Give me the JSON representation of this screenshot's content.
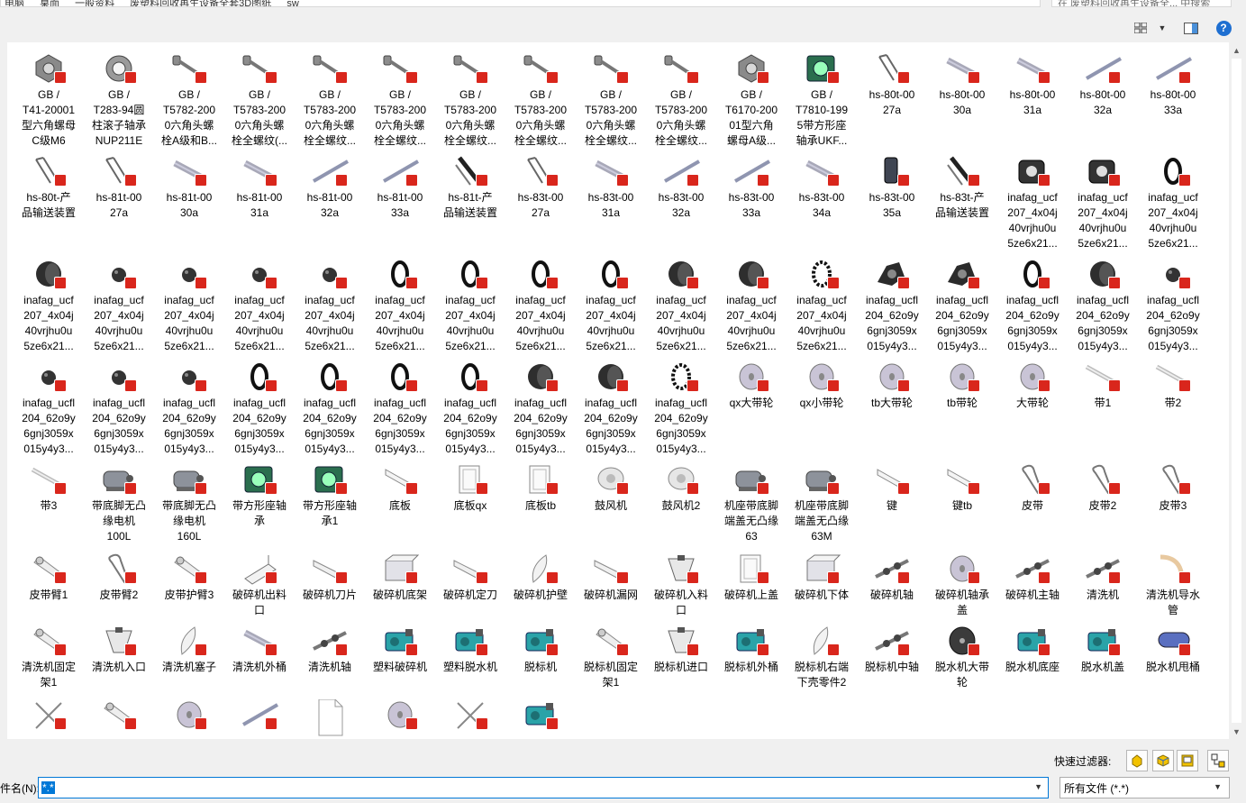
{
  "address": {
    "crumbs": [
      "电脑",
      "桌面",
      "一般资料",
      "废塑料回收再生设备全套3D图纸",
      "sw"
    ],
    "search_placeholder": "在 废塑料回收再生设备全... 中搜索"
  },
  "toolbar": {
    "views_icon": "grid-view-icon",
    "pane_icon": "preview-pane-icon",
    "help_label": "?"
  },
  "files": [
    {
      "label": "GB /\nT41-20001\n型六角螺母\nC级M6",
      "icon": "nut"
    },
    {
      "label": "GB /\nT283-94圆\n柱滚子轴承\nNUP211E",
      "icon": "bearing"
    },
    {
      "label": "GB /\nT5782-200\n0六角头螺\n栓A级和B...",
      "icon": "bolt"
    },
    {
      "label": "GB /\nT5783-200\n0六角头螺\n栓全螺纹(...",
      "icon": "bolt"
    },
    {
      "label": "GB /\nT5783-200\n0六角头螺\n栓全螺纹...",
      "icon": "bolt"
    },
    {
      "label": "GB /\nT5783-200\n0六角头螺\n栓全螺纹...",
      "icon": "bolt"
    },
    {
      "label": "GB /\nT5783-200\n0六角头螺\n栓全螺纹...",
      "icon": "bolt"
    },
    {
      "label": "GB /\nT5783-200\n0六角头螺\n栓全螺纹...",
      "icon": "bolt"
    },
    {
      "label": "GB /\nT5783-200\n0六角头螺\n栓全螺纹...",
      "icon": "bolt"
    },
    {
      "label": "GB /\nT5783-200\n0六角头螺\n栓全螺纹...",
      "icon": "bolt"
    },
    {
      "label": "GB /\nT6170-200\n01型六角\n螺母A级...",
      "icon": "nut"
    },
    {
      "label": "GB /\nT7810-199\n5带方形座\n轴承UKF...",
      "icon": "housing"
    },
    {
      "label": "hs-80t-00\n27a",
      "icon": "frame"
    },
    {
      "label": "hs-80t-00\n30a",
      "icon": "tube"
    },
    {
      "label": "hs-80t-00\n31a",
      "icon": "tube"
    },
    {
      "label": "hs-80t-00\n32a",
      "icon": "rod"
    },
    {
      "label": "hs-80t-00\n33a",
      "icon": "rod"
    },
    {
      "label": "hs-80t-产\n品输送装置",
      "icon": "frame"
    },
    {
      "label": "hs-81t-00\n27a",
      "icon": "frame"
    },
    {
      "label": "hs-81t-00\n30a",
      "icon": "tube"
    },
    {
      "label": "hs-81t-00\n31a",
      "icon": "tube"
    },
    {
      "label": "hs-81t-00\n32a",
      "icon": "rod"
    },
    {
      "label": "hs-81t-00\n33a",
      "icon": "rod"
    },
    {
      "label": "hs-81t-产\n品输送装置",
      "icon": "conveyor"
    },
    {
      "label": "hs-83t-00\n27a",
      "icon": "frame"
    },
    {
      "label": "hs-83t-00\n31a",
      "icon": "tube"
    },
    {
      "label": "hs-83t-00\n32a",
      "icon": "rod"
    },
    {
      "label": "hs-83t-00\n33a",
      "icon": "rod"
    },
    {
      "label": "hs-83t-00\n34a",
      "icon": "tube"
    },
    {
      "label": "hs-83t-00\n35a",
      "icon": "block"
    },
    {
      "label": "hs-83t-产\n品输送装置",
      "icon": "conveyor"
    },
    {
      "label": "inafag_ucf\n207_4x04j\n40vrjhu0u\n5ze6x21...",
      "icon": "housing-dark"
    },
    {
      "label": "inafag_ucf\n207_4x04j\n40vrjhu0u\n5ze6x21...",
      "icon": "housing-dark"
    },
    {
      "label": "inafag_ucf\n207_4x04j\n40vrjhu0u\n5ze6x21...",
      "icon": "ring"
    },
    {
      "label": "inafag_ucf\n207_4x04j\n40vrjhu0u\n5ze6x21...",
      "icon": "cylinder"
    },
    {
      "label": "inafag_ucf\n207_4x04j\n40vrjhu0u\n5ze6x21...",
      "icon": "ball"
    },
    {
      "label": "inafag_ucf\n207_4x04j\n40vrjhu0u\n5ze6x21...",
      "icon": "ball"
    },
    {
      "label": "inafag_ucf\n207_4x04j\n40vrjhu0u\n5ze6x21...",
      "icon": "ball"
    },
    {
      "label": "inafag_ucf\n207_4x04j\n40vrjhu0u\n5ze6x21...",
      "icon": "ball"
    },
    {
      "label": "inafag_ucf\n207_4x04j\n40vrjhu0u\n5ze6x21...",
      "icon": "ring"
    },
    {
      "label": "inafag_ucf\n207_4x04j\n40vrjhu0u\n5ze6x21...",
      "icon": "ring"
    },
    {
      "label": "inafag_ucf\n207_4x04j\n40vrjhu0u\n5ze6x21...",
      "icon": "ring"
    },
    {
      "label": "inafag_ucf\n207_4x04j\n40vrjhu0u\n5ze6x21...",
      "icon": "ring"
    },
    {
      "label": "inafag_ucf\n207_4x04j\n40vrjhu0u\n5ze6x21...",
      "icon": "cylinder"
    },
    {
      "label": "inafag_ucf\n207_4x04j\n40vrjhu0u\n5ze6x21...",
      "icon": "cylinder"
    },
    {
      "label": "inafag_ucf\n207_4x04j\n40vrjhu0u\n5ze6x21...",
      "icon": "ring-dashed"
    },
    {
      "label": "inafag_ucfl\n204_62o9y\n6gnj3059x\n015y4y3...",
      "icon": "flange"
    },
    {
      "label": "inafag_ucfl\n204_62o9y\n6gnj3059x\n015y4y3...",
      "icon": "flange"
    },
    {
      "label": "inafag_ucfl\n204_62o9y\n6gnj3059x\n015y4y3...",
      "icon": "ring"
    },
    {
      "label": "inafag_ucfl\n204_62o9y\n6gnj3059x\n015y4y3...",
      "icon": "cylinder"
    },
    {
      "label": "inafag_ucfl\n204_62o9y\n6gnj3059x\n015y4y3...",
      "icon": "ball"
    },
    {
      "label": "inafag_ucfl\n204_62o9y\n6gnj3059x\n015y4y3...",
      "icon": "ball"
    },
    {
      "label": "inafag_ucfl\n204_62o9y\n6gnj3059x\n015y4y3...",
      "icon": "ball"
    },
    {
      "label": "inafag_ucfl\n204_62o9y\n6gnj3059x\n015y4y3...",
      "icon": "ball"
    },
    {
      "label": "inafag_ucfl\n204_62o9y\n6gnj3059x\n015y4y3...",
      "icon": "ring"
    },
    {
      "label": "inafag_ucfl\n204_62o9y\n6gnj3059x\n015y4y3...",
      "icon": "ring"
    },
    {
      "label": "inafag_ucfl\n204_62o9y\n6gnj3059x\n015y4y3...",
      "icon": "ring"
    },
    {
      "label": "inafag_ucfl\n204_62o9y\n6gnj3059x\n015y4y3...",
      "icon": "ring"
    },
    {
      "label": "inafag_ucfl\n204_62o9y\n6gnj3059x\n015y4y3...",
      "icon": "cylinder"
    },
    {
      "label": "inafag_ucfl\n204_62o9y\n6gnj3059x\n015y4y3...",
      "icon": "cylinder"
    },
    {
      "label": "inafag_ucfl\n204_62o9y\n6gnj3059x\n015y4y3...",
      "icon": "ring-dashed"
    },
    {
      "label": "qx大带轮",
      "icon": "pulley"
    },
    {
      "label": "qx小带轮",
      "icon": "pulley"
    },
    {
      "label": "tb大带轮",
      "icon": "pulley"
    },
    {
      "label": "tb带轮",
      "icon": "pulley"
    },
    {
      "label": "大带轮",
      "icon": "pulley"
    },
    {
      "label": "带1",
      "icon": "belt"
    },
    {
      "label": "带2",
      "icon": "belt"
    },
    {
      "label": "带3",
      "icon": "belt"
    },
    {
      "label": "带底脚无凸\n缘电机\n100L",
      "icon": "motor"
    },
    {
      "label": "带底脚无凸\n缘电机\n160L",
      "icon": "motor"
    },
    {
      "label": "带方形座轴\n承",
      "icon": "housing"
    },
    {
      "label": "带方形座轴\n承1",
      "icon": "housing"
    },
    {
      "label": "底板",
      "icon": "plate"
    },
    {
      "label": "底板qx",
      "icon": "panel"
    },
    {
      "label": "底板tb",
      "icon": "panel"
    },
    {
      "label": "鼓风机",
      "icon": "fan"
    },
    {
      "label": "鼓风机2",
      "icon": "fan"
    },
    {
      "label": "机座带底脚\n端盖无凸缘\n63",
      "icon": "motor"
    },
    {
      "label": "机座带底脚\n端盖无凸缘\n63M",
      "icon": "motor"
    },
    {
      "label": "键",
      "icon": "plate"
    },
    {
      "label": "键tb",
      "icon": "plate"
    },
    {
      "label": "皮带",
      "icon": "loop"
    },
    {
      "label": "皮带2",
      "icon": "loop"
    },
    {
      "label": "皮带3",
      "icon": "loop"
    },
    {
      "label": "皮带臂1",
      "icon": "arm"
    },
    {
      "label": "皮带臂2",
      "icon": "loop"
    },
    {
      "label": "皮带护臂3",
      "icon": "arm"
    },
    {
      "label": "破碎机出料\n口",
      "icon": "chute"
    },
    {
      "label": "破碎机刀片",
      "icon": "blade"
    },
    {
      "label": "破碎机底架",
      "icon": "box"
    },
    {
      "label": "破碎机定刀",
      "icon": "blade"
    },
    {
      "label": "破碎机护壁",
      "icon": "leaf"
    },
    {
      "label": "破碎机漏网",
      "icon": "blade"
    },
    {
      "label": "破碎机入料\n口",
      "icon": "hopper"
    },
    {
      "label": "破碎机上盖",
      "icon": "panel"
    },
    {
      "label": "破碎机下体",
      "icon": "box"
    },
    {
      "label": "破碎机轴",
      "icon": "shaft"
    },
    {
      "label": "破碎机轴承\n盖",
      "icon": "pulley"
    },
    {
      "label": "破碎机主轴",
      "icon": "shaft"
    },
    {
      "label": "清洗机",
      "icon": "shaft"
    },
    {
      "label": "清洗机导水\n管",
      "icon": "pipe"
    },
    {
      "label": "清洗机固定\n架1",
      "icon": "arm"
    },
    {
      "label": "清洗机入口",
      "icon": "hopper"
    },
    {
      "label": "清洗机塞子",
      "icon": "leaf"
    },
    {
      "label": "清洗机外桶",
      "icon": "tube"
    },
    {
      "label": "清洗机轴",
      "icon": "shaft"
    },
    {
      "label": "塑料破碎机",
      "icon": "machine"
    },
    {
      "label": "塑料脱水机",
      "icon": "machine"
    },
    {
      "label": "脱标机",
      "icon": "machine"
    },
    {
      "label": "脱标机固定\n架1",
      "icon": "arm"
    },
    {
      "label": "脱标机进口",
      "icon": "hopper"
    },
    {
      "label": "脱标机外桶",
      "icon": "machine"
    },
    {
      "label": "脱标机右端\n下壳零件2",
      "icon": "leaf"
    },
    {
      "label": "脱标机中轴",
      "icon": "shaft"
    },
    {
      "label": "脱水机大带\n轮",
      "icon": "pulley-dark"
    },
    {
      "label": "脱水机底座",
      "icon": "machine"
    },
    {
      "label": "脱水机盖",
      "icon": "machine"
    },
    {
      "label": "脱水机甩桶",
      "icon": "tube-blue"
    },
    {
      "label": "",
      "icon": "cross"
    },
    {
      "label": "",
      "icon": "arm"
    },
    {
      "label": "",
      "icon": "pulley"
    },
    {
      "label": "",
      "icon": "rod"
    },
    {
      "label": "",
      "icon": "blank-doc"
    },
    {
      "label": "",
      "icon": "pulley"
    },
    {
      "label": "",
      "icon": "cross"
    },
    {
      "label": "",
      "icon": "machine"
    }
  ],
  "bottom": {
    "quick_filter_label": "快速过滤器:",
    "filename_label": "件名(N):",
    "filename_value": "*.*",
    "filetype_value": "所有文件 (*.*)"
  },
  "colors": {
    "sw_badge": "#d9261c",
    "selection": "#0078d7"
  }
}
